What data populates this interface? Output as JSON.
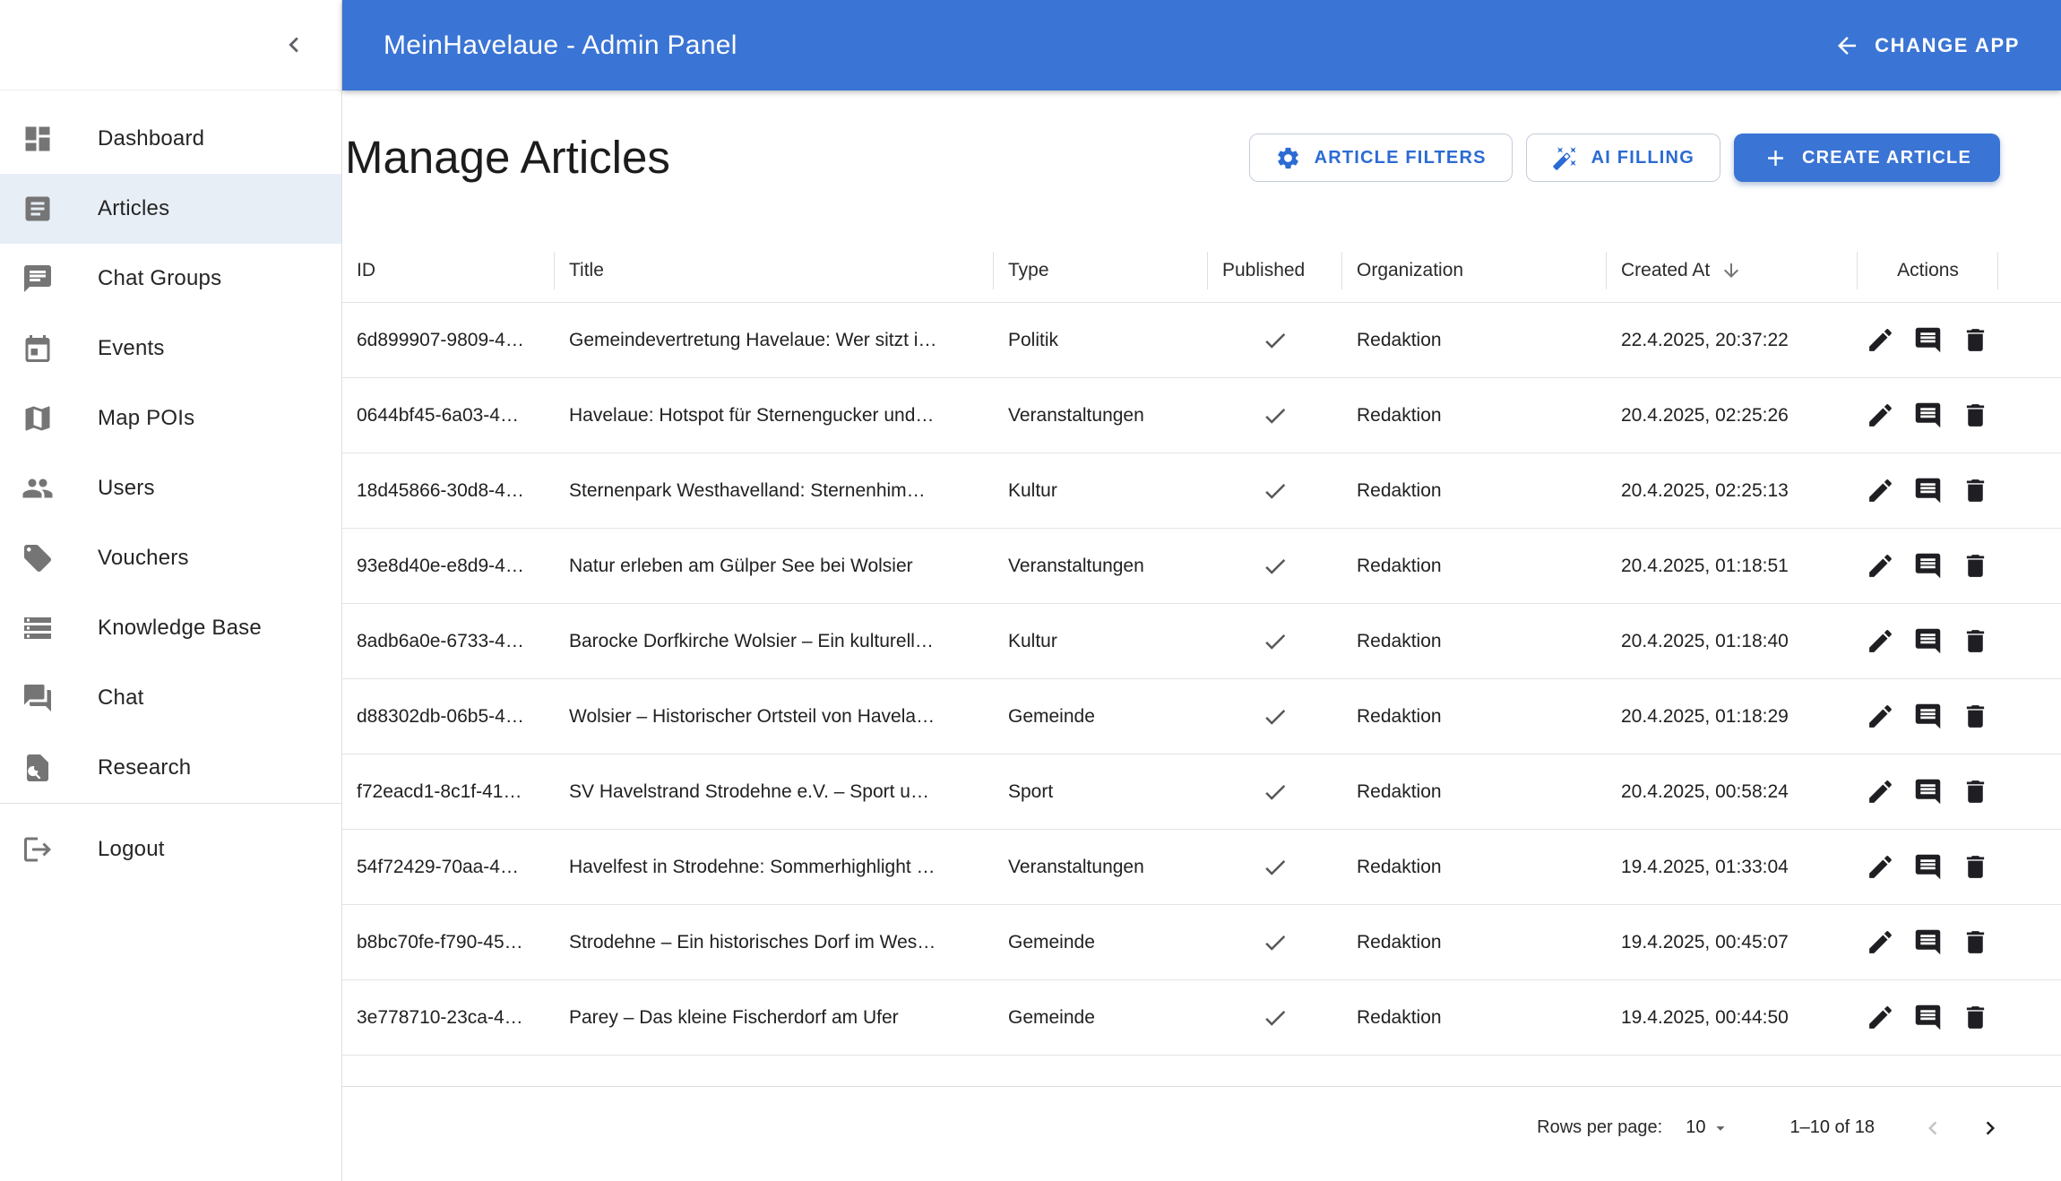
{
  "app_bar": {
    "title": "MeinHavelaue - Admin Panel",
    "change_app_label": "CHANGE APP"
  },
  "sidebar": {
    "items": [
      {
        "label": "Dashboard",
        "icon": "dashboard-icon",
        "active": false
      },
      {
        "label": "Articles",
        "icon": "article-icon",
        "active": true
      },
      {
        "label": "Chat Groups",
        "icon": "chat-bubble-icon",
        "active": false
      },
      {
        "label": "Events",
        "icon": "calendar-icon",
        "active": false
      },
      {
        "label": "Map POIs",
        "icon": "map-icon",
        "active": false
      },
      {
        "label": "Users",
        "icon": "people-icon",
        "active": false
      },
      {
        "label": "Vouchers",
        "icon": "tag-icon",
        "active": false
      },
      {
        "label": "Knowledge Base",
        "icon": "storage-icon",
        "active": false
      },
      {
        "label": "Chat",
        "icon": "forum-icon",
        "active": false
      },
      {
        "label": "Research",
        "icon": "doc-search-icon",
        "active": false
      }
    ],
    "logout": {
      "label": "Logout",
      "icon": "logout-icon"
    }
  },
  "page": {
    "title": "Manage Articles"
  },
  "toolbar": {
    "filters_label": "ARTICLE FILTERS",
    "ai_filling_label": "AI FILLING",
    "create_label": "CREATE ARTICLE"
  },
  "table": {
    "columns": [
      "ID",
      "Title",
      "Type",
      "Published",
      "Organization",
      "Created At",
      "Actions"
    ],
    "sorted_by": "Created At",
    "sort_direction": "desc",
    "rows": [
      {
        "id": "6d899907-9809-4…",
        "title": "Gemeindevertretung Havelaue: Wer sitzt i…",
        "type": "Politik",
        "published": true,
        "organization": "Redaktion",
        "created_at": "22.4.2025, 20:37:22"
      },
      {
        "id": "0644bf45-6a03-4…",
        "title": "Havelaue: Hotspot für Sternengucker und…",
        "type": "Veranstaltungen",
        "published": true,
        "organization": "Redaktion",
        "created_at": "20.4.2025, 02:25:26"
      },
      {
        "id": "18d45866-30d8-4…",
        "title": "Sternenpark Westhavelland: Sternenhim…",
        "type": "Kultur",
        "published": true,
        "organization": "Redaktion",
        "created_at": "20.4.2025, 02:25:13"
      },
      {
        "id": "93e8d40e-e8d9-4…",
        "title": "Natur erleben am Gülper See bei Wolsier",
        "type": "Veranstaltungen",
        "published": true,
        "organization": "Redaktion",
        "created_at": "20.4.2025, 01:18:51"
      },
      {
        "id": "8adb6a0e-6733-4…",
        "title": "Barocke Dorfkirche Wolsier – Ein kulturell…",
        "type": "Kultur",
        "published": true,
        "organization": "Redaktion",
        "created_at": "20.4.2025, 01:18:40"
      },
      {
        "id": "d88302db-06b5-4…",
        "title": "Wolsier – Historischer Ortsteil von Havela…",
        "type": "Gemeinde",
        "published": true,
        "organization": "Redaktion",
        "created_at": "20.4.2025, 01:18:29"
      },
      {
        "id": "f72eacd1-8c1f-41…",
        "title": "SV Havelstrand Strodehne e.V. – Sport u…",
        "type": "Sport",
        "published": true,
        "organization": "Redaktion",
        "created_at": "20.4.2025, 00:58:24"
      },
      {
        "id": "54f72429-70aa-4…",
        "title": "Havelfest in Strodehne: Sommerhighlight …",
        "type": "Veranstaltungen",
        "published": true,
        "organization": "Redaktion",
        "created_at": "19.4.2025, 01:33:04"
      },
      {
        "id": "b8bc70fe-f790-45…",
        "title": "Strodehne – Ein historisches Dorf im Wes…",
        "type": "Gemeinde",
        "published": true,
        "organization": "Redaktion",
        "created_at": "19.4.2025, 00:45:07"
      },
      {
        "id": "3e778710-23ca-4…",
        "title": "Parey – Das kleine Fischerdorf am Ufer",
        "type": "Gemeinde",
        "published": true,
        "organization": "Redaktion",
        "created_at": "19.4.2025, 00:44:50"
      }
    ]
  },
  "pagination": {
    "rows_per_page_label": "Rows per page:",
    "rows_per_page_value": "10",
    "range_label": "1–10 of 18"
  },
  "colors": {
    "primary_blue": "#3a74d4",
    "button_text_blue": "#2b6bd3",
    "active_item_bg": "#e8eef6",
    "divider": "#e0e0e0",
    "icon_gray": "#757575",
    "text": "#212121"
  }
}
